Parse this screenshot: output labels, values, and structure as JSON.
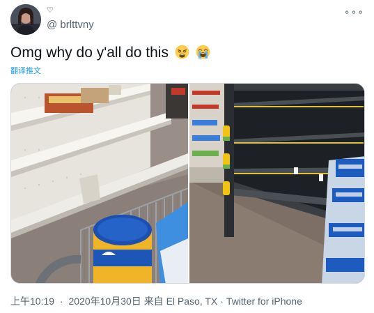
{
  "author": {
    "handle": "@ brlttvny",
    "name_glyph": "♡"
  },
  "menu_glyph": "∘∘∘",
  "tweet": {
    "text": "Omg why do y'all do this",
    "emoji": [
      "weary-face",
      "loudly-crying-face"
    ],
    "translate_label": "翻译推文"
  },
  "media": {
    "photos": [
      {
        "name": "empty-store-shelves-with-shopping-cart"
      },
      {
        "name": "empty-refrigerated-shelves-with-water-bottles"
      }
    ]
  },
  "meta": {
    "time": "上午10:19",
    "date": "2020年10月30日",
    "location": "来自 El Paso, TX",
    "source": "Twitter for iPhone"
  },
  "colors": {
    "link": "#1d9bf0",
    "secondary_text": "#536471",
    "primary_text": "#0f1419",
    "border": "#cfd9de"
  }
}
